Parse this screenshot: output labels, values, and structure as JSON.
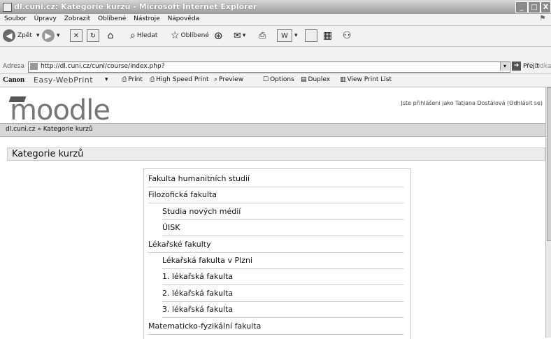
{
  "window": {
    "title": "dl.cuni.cz: Kategorie kurzů - Microsoft Internet Explorer",
    "controls": [
      "_",
      "□",
      "X"
    ]
  },
  "menu": [
    "Soubor",
    "Úpravy",
    "Zobrazit",
    "Oblíbené",
    "Nástroje",
    "Nápověda"
  ],
  "navbar": {
    "back": "Zpět",
    "search": "Hledat",
    "favorites": "Oblíbené"
  },
  "address": {
    "label": "Adresa",
    "url": "http://dl.cuni.cz/cuni/course/index.php?",
    "go": "Přejít",
    "links": "Odkazy"
  },
  "canon": {
    "brand": "Canon",
    "product": "Easy-WebPrint",
    "buttons": [
      "Print",
      "High Speed Print",
      "Preview",
      "Options",
      "Duplex",
      "View Print List"
    ]
  },
  "page": {
    "logo": "moodle",
    "logged_in": "Jste přihlášeni jako Tatjana Dostálová (Odhlásit se)",
    "breadcrumb": "dl.cuni.cz » Kategorie kurzů",
    "heading": "Kategorie kurzů",
    "categories": [
      {
        "label": "Fakulta humanitních studií",
        "level": 0
      },
      {
        "label": "Filozofická fakulta",
        "level": 0
      },
      {
        "label": "Studia nových médií",
        "level": 1
      },
      {
        "label": "ÚISK",
        "level": 1
      },
      {
        "label": "Lékařské fakulty",
        "level": 0
      },
      {
        "label": "Lékařská fakulta v Plzni",
        "level": 1
      },
      {
        "label": "1. lékařská fakulta",
        "level": 1
      },
      {
        "label": "2. lékařská fakulta",
        "level": 1
      },
      {
        "label": "3. lékařská fakulta",
        "level": 1
      },
      {
        "label": "Matematicko-fyzikální fakulta",
        "level": 0
      }
    ]
  }
}
